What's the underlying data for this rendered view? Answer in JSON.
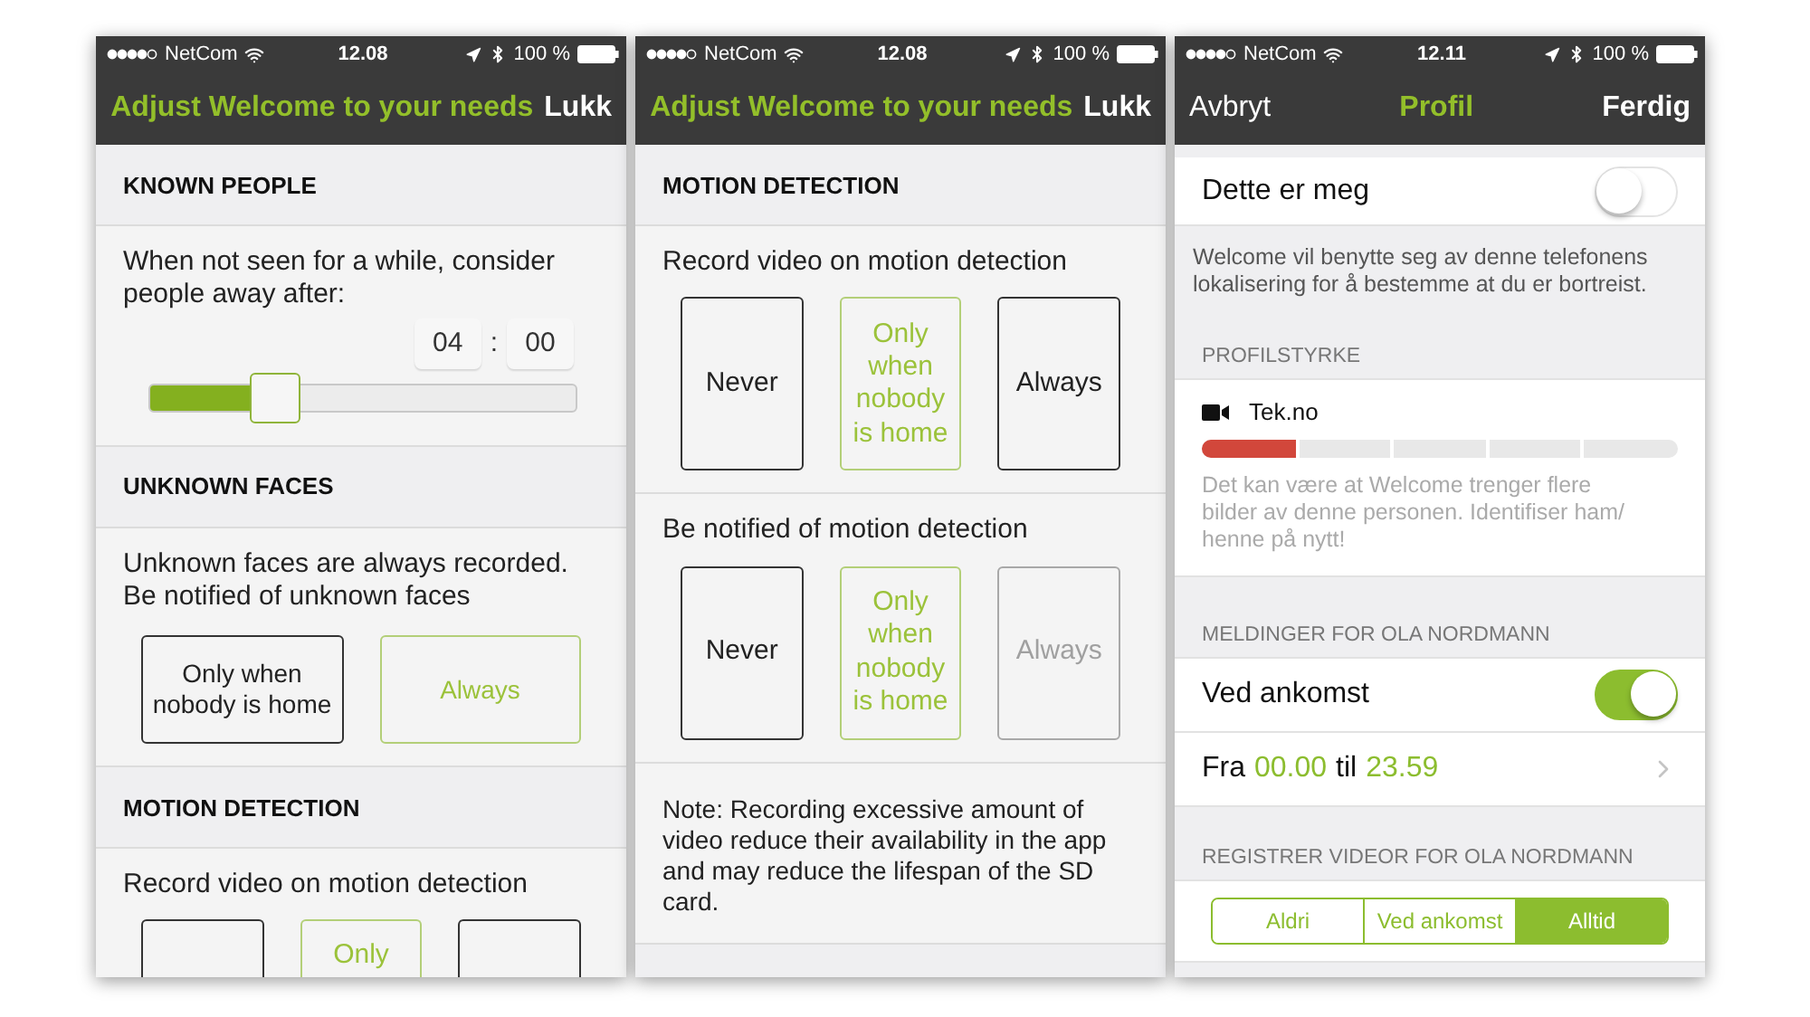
{
  "phones": [
    {
      "kind": "settings",
      "status_bar": {
        "carrier": "NetCom",
        "time": "12.08",
        "battery": "100 %"
      },
      "nav": {
        "title": "Adjust Welcome to your needs",
        "close": "Lukk"
      },
      "sections": [
        {
          "header": "KNOWN PEOPLE",
          "items": [
            {
              "kind": "duration",
              "text": "When not seen for a while, consider people away after:",
              "hours": "04",
              "separator": ":",
              "minutes": "00",
              "level": 0.27
            }
          ]
        },
        {
          "header": "UNKNOWN FACES",
          "items": [
            {
              "kind": "choice",
              "text": "Unknown faces are always recorded. Be notified of unknown faces",
              "options": [
                {
                  "label": "Only when nobody is home",
                  "selected": false,
                  "disabled": false
                },
                {
                  "label": "Always",
                  "selected": true,
                  "disabled": false
                }
              ]
            }
          ]
        },
        {
          "header": "MOTION DETECTION",
          "items": [
            {
              "kind": "partial_choice",
              "text": "Record video on motion detection",
              "options": [
                {
                  "selected": false,
                  "disabled": false
                },
                {
                  "label": "Only",
                  "selected": true,
                  "disabled": false
                },
                {
                  "selected": false,
                  "disabled": false
                }
              ]
            }
          ]
        }
      ]
    },
    {
      "kind": "settings",
      "status_bar": {
        "carrier": "NetCom",
        "time": "12.08",
        "battery": "100 %"
      },
      "nav": {
        "title": "Adjust Welcome to your needs",
        "close": "Lukk"
      },
      "sections": [
        {
          "header": "MOTION DETECTION",
          "items": [
            {
              "kind": "choice",
              "text": "Record video on motion detection",
              "options": [
                {
                  "label": "Never",
                  "selected": false,
                  "disabled": false
                },
                {
                  "label": "Only when nobody is home",
                  "selected": true,
                  "disabled": false
                },
                {
                  "label": "Always",
                  "selected": false,
                  "disabled": false
                }
              ]
            },
            {
              "kind": "choice",
              "text": "Be notified of motion detection",
              "options": [
                {
                  "label": "Never",
                  "selected": false,
                  "disabled": false
                },
                {
                  "label": "Only when nobody is home",
                  "selected": true,
                  "disabled": false
                },
                {
                  "label": "Always",
                  "selected": false,
                  "disabled": true
                }
              ]
            },
            {
              "kind": "note",
              "text": "Note: Recording excessive amount of video reduce their availability in the app and may reduce the lifespan of the SD card."
            }
          ]
        }
      ]
    },
    {
      "kind": "profile",
      "status_bar": {
        "carrier": "NetCom",
        "time": "12.11",
        "battery": "100 %"
      },
      "nav": {
        "cancel": "Avbryt",
        "title": "Profil",
        "done": "Ferdig"
      },
      "me_toggle": {
        "label": "Dette er meg",
        "on": false
      },
      "location_note": "Welcome vil benytte seg av denne telefonens lokalisering for å bestemme at du er bortreist.",
      "strength": {
        "header": "PROFILSTYRKE",
        "name": "Tek.no",
        "level": 0.2,
        "hint": "Det kan være at Welcome trenger flere bilder av denne personen. Identifiser ham/ henne på nytt!"
      },
      "notifications": {
        "header": "MELDINGER FOR OLA NORDMANN",
        "arrival": {
          "label": "Ved ankomst",
          "on": true
        },
        "range": {
          "from_label": "Fra",
          "from": "00.00",
          "to_label": "til",
          "to": "23.59"
        }
      },
      "video": {
        "header": "REGISTRER VIDEOR FOR OLA NORDMANN",
        "options": [
          {
            "label": "Aldri",
            "selected": false
          },
          {
            "label": "Ved ankomst",
            "selected": false
          },
          {
            "label": "Alltid",
            "selected": true
          }
        ]
      }
    }
  ]
}
